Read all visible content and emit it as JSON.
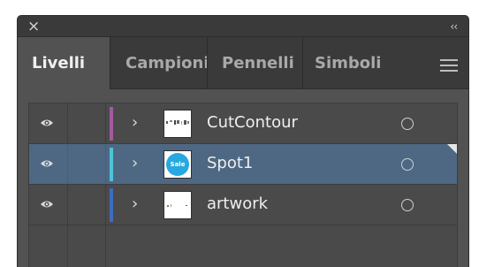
{
  "window": {
    "close_icon": "×",
    "collapse_icon": "‹‹"
  },
  "tabs": [
    {
      "label": "Livelli",
      "active": true
    },
    {
      "label": "Campioni",
      "active": false
    },
    {
      "label": "Pennelli",
      "active": false
    },
    {
      "label": "Simboli",
      "active": false
    }
  ],
  "layers": [
    {
      "name": "CutContour",
      "color": "#a35aa0",
      "selected": false,
      "visible": true
    },
    {
      "name": "Spot1",
      "color": "#4fc3d6",
      "selected": true,
      "visible": true,
      "thumb_text": "Sale"
    },
    {
      "name": "artwork",
      "color": "#3f6cc0",
      "selected": false,
      "visible": true
    }
  ],
  "icons": {
    "expand": "›"
  }
}
